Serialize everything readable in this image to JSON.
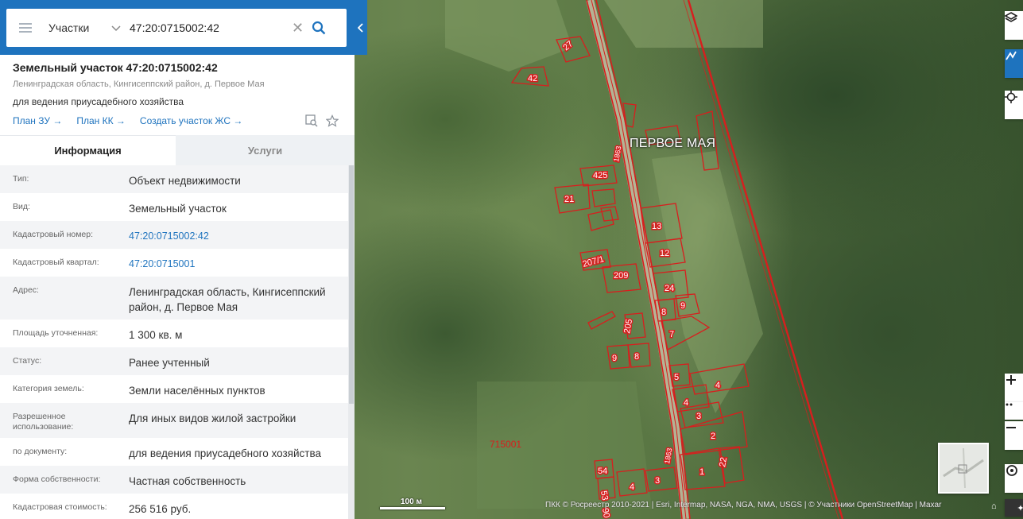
{
  "search": {
    "mode": "Участки",
    "value": "47:20:0715002:42"
  },
  "object": {
    "title": "Земельный участок 47:20:0715002:42",
    "address": "Ленинградская область, Кингисеппский район, д. Первое Мая",
    "purpose": "для ведения приусадебного хозяйства",
    "links": [
      "План ЗУ →",
      "План КК →",
      "Создать участок ЖС →"
    ]
  },
  "tabs": {
    "info": "Информация",
    "services": "Услуги"
  },
  "details": [
    {
      "key": "Тип:",
      "value": "Объект недвижимости"
    },
    {
      "key": "Вид:",
      "value": "Земельный участок"
    },
    {
      "key": "Кадастровый номер:",
      "value": "47:20:0715002:42"
    },
    {
      "key": "Кадастровый квартал:",
      "value": "47:20:0715001"
    },
    {
      "key": "Адрес:",
      "value": "Ленинградская область, Кингисеппский район, д. Первое Мая"
    },
    {
      "key": "Площадь уточненная:",
      "value": "1 300 кв. м"
    },
    {
      "key": "Статус:",
      "value": "Ранее учтенный"
    },
    {
      "key": "Категория земель:",
      "value": "Земли населённых пунктов"
    },
    {
      "key": "Разрешенное использование:",
      "value": "Для иных видов жилой застройки"
    },
    {
      "key": "по документу:",
      "value": "для ведения приусадебного хозяйства"
    },
    {
      "key": "Форма собственности:",
      "value": "Частная собственность"
    },
    {
      "key": "Кадастровая стоимость:",
      "value": "256 516 руб."
    }
  ],
  "map": {
    "village_label": "ПЕРВОЕ МАЯ",
    "quarter_label": "715001",
    "scale_label": "100 м",
    "credits": "ПКК © Росреестр 2010-2021 | Esri, Intermap, NASA, NGA, NMA, USGS | © Участники OpenStreetMap | Maxar",
    "parcel_numbers": [
      "27",
      "42",
      "425",
      "21",
      "13",
      "12",
      "207/1",
      "209",
      "24",
      "8",
      "9",
      "7",
      "205",
      "9",
      "8",
      "5",
      "4",
      "4",
      "3",
      "2",
      "1",
      "22",
      "54",
      "53",
      "4",
      "3",
      "90"
    ],
    "road_labels": [
      "1863",
      "1863"
    ],
    "parcel_color": "#d81e1e",
    "accent_color": "#1e73be"
  }
}
